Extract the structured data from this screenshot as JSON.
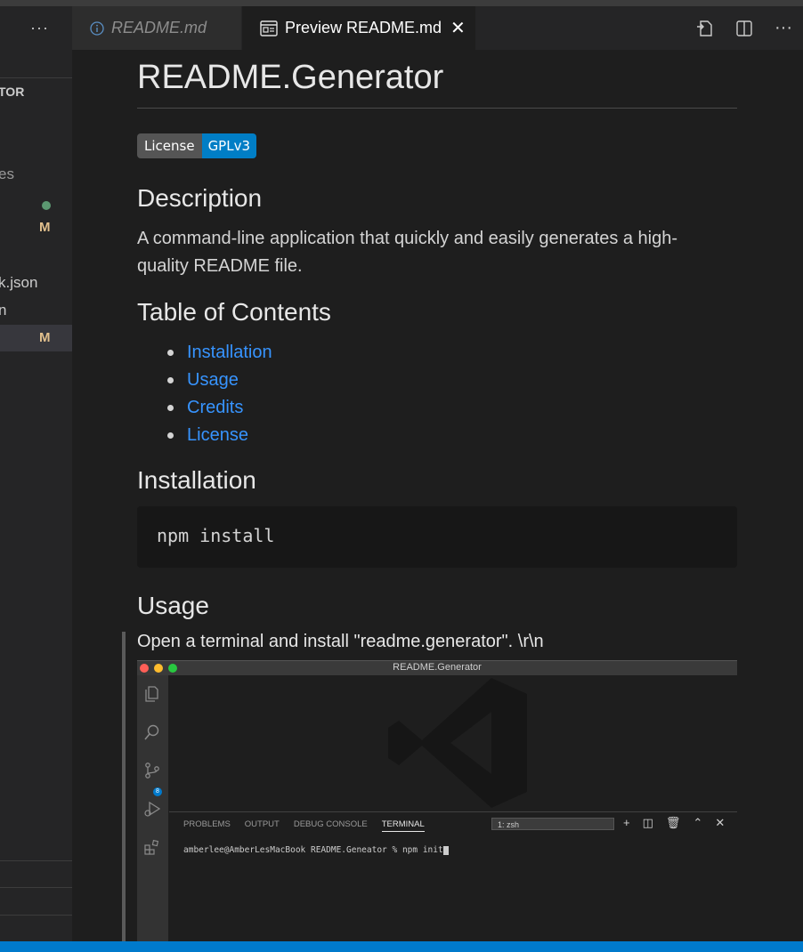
{
  "sidebar": {
    "more_label": "···",
    "section_title": "TOR",
    "items": [
      {
        "label": "es",
        "badge": ""
      },
      {
        "label": "",
        "badge": "M"
      },
      {
        "label": "k.json",
        "badge": ""
      },
      {
        "label": "n",
        "badge": ""
      },
      {
        "label": "",
        "badge": "M"
      }
    ]
  },
  "tabs": [
    {
      "label": "README.md",
      "icon": "info-icon",
      "active": false
    },
    {
      "label": "Preview README.md",
      "icon": "preview-icon",
      "active": true
    }
  ],
  "editor_actions": [
    "open-source-icon",
    "split-editor-icon",
    "more-actions-icon"
  ],
  "readme": {
    "title": "README.Generator",
    "license_badge": {
      "left": "License",
      "right": "GPLv3",
      "left_color": "#555555",
      "right_color": "#007ec6"
    },
    "description_heading": "Description",
    "description_text": "A command-line application that quickly and easily generates a high-quality README file.",
    "toc_heading": "Table of Contents",
    "toc": [
      "Installation",
      "Usage",
      "Credits",
      "License"
    ],
    "installation_heading": "Installation",
    "install_code": "npm install",
    "usage_heading": "Usage",
    "usage_text": "Open a terminal and install \"readme.generator\". \\r\\n"
  },
  "embedded_screenshot": {
    "window_title": "README.Generator",
    "panel_tabs": [
      "PROBLEMS",
      "OUTPUT",
      "DEBUG CONSOLE",
      "TERMINAL"
    ],
    "active_panel_tab": "TERMINAL",
    "terminal_select": "1: zsh",
    "scm_badge": "8",
    "terminal_line": "amberlee@AmberLesMacBook README.Geneator % npm init"
  },
  "colors": {
    "link": "#3794ff",
    "accent": "#007acc",
    "modified": "#e2c08d"
  }
}
